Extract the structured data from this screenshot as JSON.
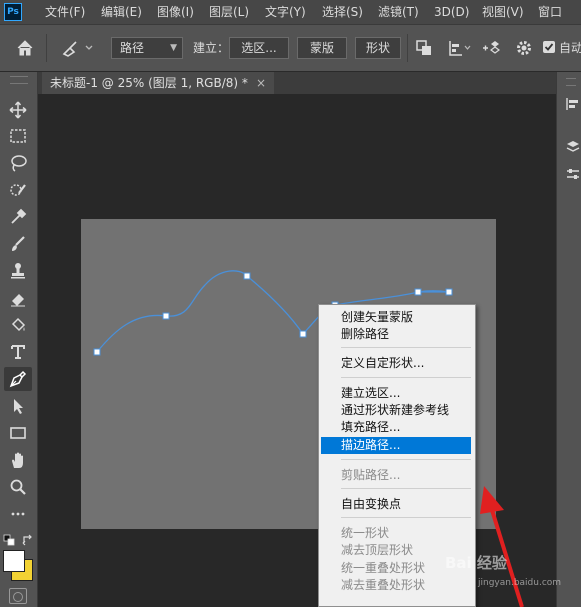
{
  "app": {
    "logo_text": "Ps"
  },
  "menubar": {
    "items": [
      "文件(F)",
      "编辑(E)",
      "图像(I)",
      "图层(L)",
      "文字(Y)",
      "选择(S)",
      "滤镜(T)",
      "3D(D)",
      "视图(V)",
      "窗口"
    ]
  },
  "options": {
    "mode_value": "路径",
    "make_label": "建立：",
    "selection_button": "选区...",
    "mask_button": "蒙版",
    "shape_button": "形状",
    "auto_add_label": "自动"
  },
  "document": {
    "tab_title": "未标题-1 @ 25% (图层 1, RGB/8) *",
    "close_glyph": "×"
  },
  "context_menu": {
    "group1": [
      "创建矢量蒙版",
      "删除路径"
    ],
    "group2": [
      "定义自定形状..."
    ],
    "group3": [
      "建立选区...",
      "通过形状新建参考线",
      "填充路径...",
      "描边路径..."
    ],
    "group4": [
      "剪贴路径..."
    ],
    "group5": [
      "自由变换点"
    ],
    "group6": [
      "统一形状",
      "减去顶层形状",
      "统一重叠处形状",
      "减去重叠处形状"
    ],
    "highlighted": "描边路径..."
  },
  "watermark": {
    "text": "Bai 经验",
    "url": "jingyan.baidu.com"
  },
  "colors": {
    "foreground": "#ffffff",
    "background": "#f2d233",
    "highlight": "#0078d7",
    "path_stroke": "#4a90d9",
    "arrow": "#e02020"
  }
}
